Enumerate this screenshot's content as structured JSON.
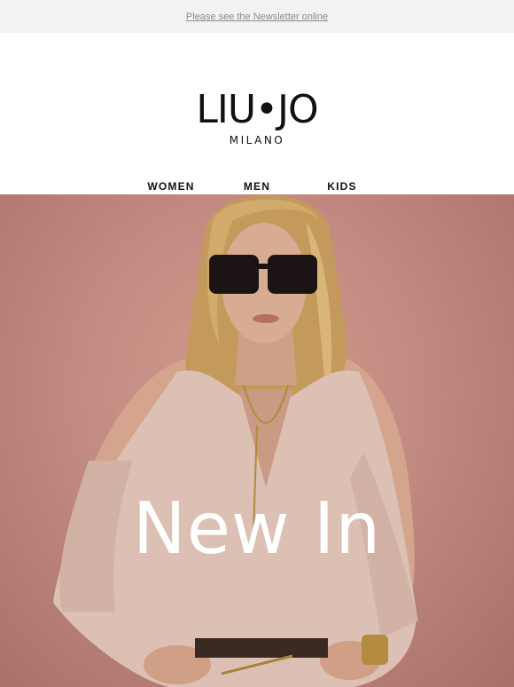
{
  "topbar": {
    "newsletter_link": "Please see the Newsletter online"
  },
  "brand": {
    "logo_text": "LIU•JO",
    "logo_sub": "MILANO"
  },
  "nav": {
    "items": [
      {
        "label": "WOMEN"
      },
      {
        "label": "MEN"
      },
      {
        "label": "KIDS"
      }
    ]
  },
  "hero": {
    "title": "New In"
  },
  "colors": {
    "topbar_bg": "#f2f2f2",
    "link": "#8a8a8a",
    "hero_wall": "#c28a80",
    "blouse": "#dcc0b3",
    "hair": "#caa161",
    "skin": "#d8ac93"
  },
  "icons": [
    "sunglasses-icon",
    "necklace-icon",
    "bracelet-icon"
  ]
}
